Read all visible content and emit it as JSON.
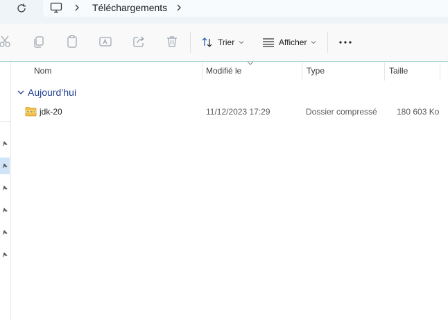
{
  "address_bar": {
    "refresh_icon": "refresh-icon",
    "location_icon": "this-pc-icon",
    "breadcrumb": [
      "Téléchargements"
    ]
  },
  "toolbar": {
    "icons": [
      "cut-icon",
      "copy-icon",
      "paste-icon",
      "rename-icon",
      "share-icon",
      "delete-icon"
    ],
    "sort_label": "Trier",
    "view_label": "Afficher",
    "more_icon": "more-icon"
  },
  "columns": {
    "name": "Nom",
    "modified": "Modifié le",
    "type": "Type",
    "size": "Taille"
  },
  "groups": [
    {
      "label": "Aujourd’hui",
      "files": [
        {
          "name": "jdk-20",
          "modified": "11/12/2023 17:29",
          "type": "Dossier compressé",
          "size": "180 603 Ko",
          "icon": "zip-folder-icon"
        }
      ]
    }
  ],
  "colors": {
    "accent": "#1f3f8f",
    "toolbar_border": "#a9d6d2",
    "folder": "#f2c14b",
    "selection": "#cfe4f7"
  }
}
